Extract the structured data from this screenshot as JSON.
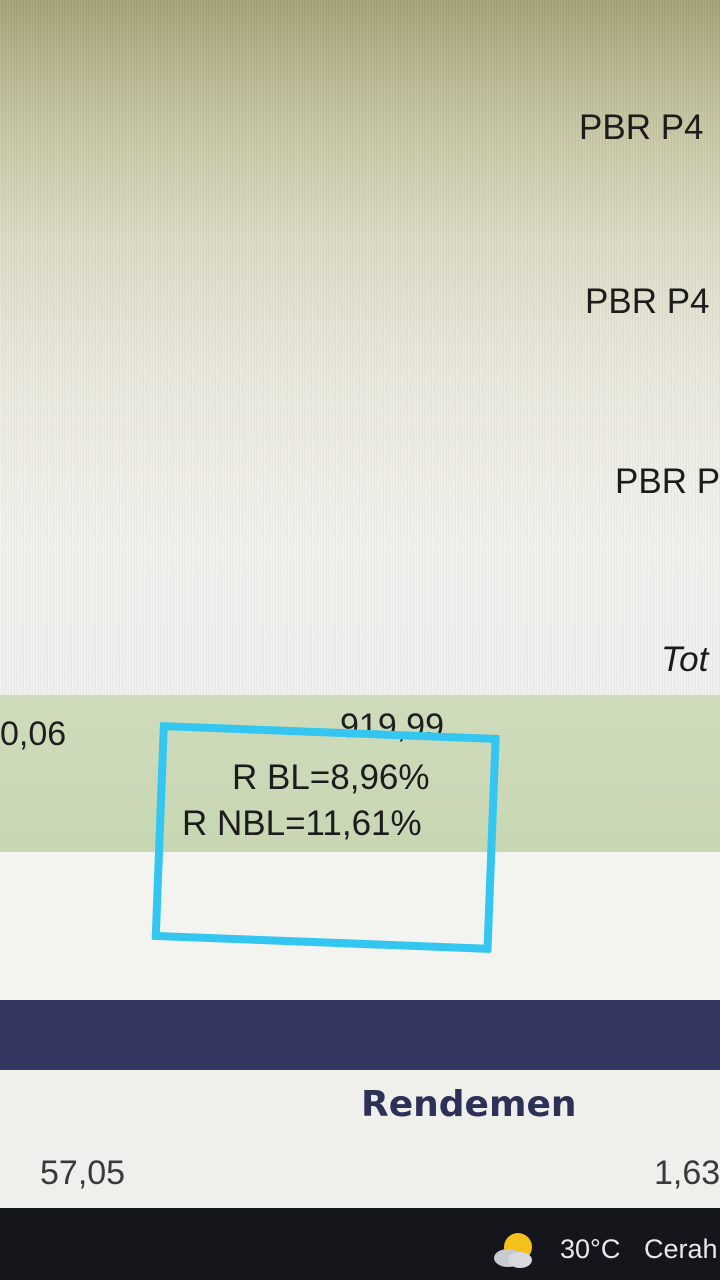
{
  "spreadsheet": {
    "row_labels": [
      "PBR P4",
      "PBR P4",
      "PBR P",
      "Tot"
    ],
    "green_row": {
      "left_value": "0,06",
      "right_value": "919,99"
    },
    "annotations": {
      "line1": "R BL=8,96%",
      "line2": "R NBL=11,61%"
    },
    "summary": {
      "heading": "Rendemen",
      "left_value": "57,05",
      "right_value": "1,63"
    }
  },
  "taskbar": {
    "temperature": "30°C",
    "condition": "Cerah",
    "weather_icon": "partly-sunny-icon"
  },
  "colors": {
    "highlight_box": "#32c6f0",
    "header_bar": "#323660",
    "green_row": "#c7d6b3"
  }
}
